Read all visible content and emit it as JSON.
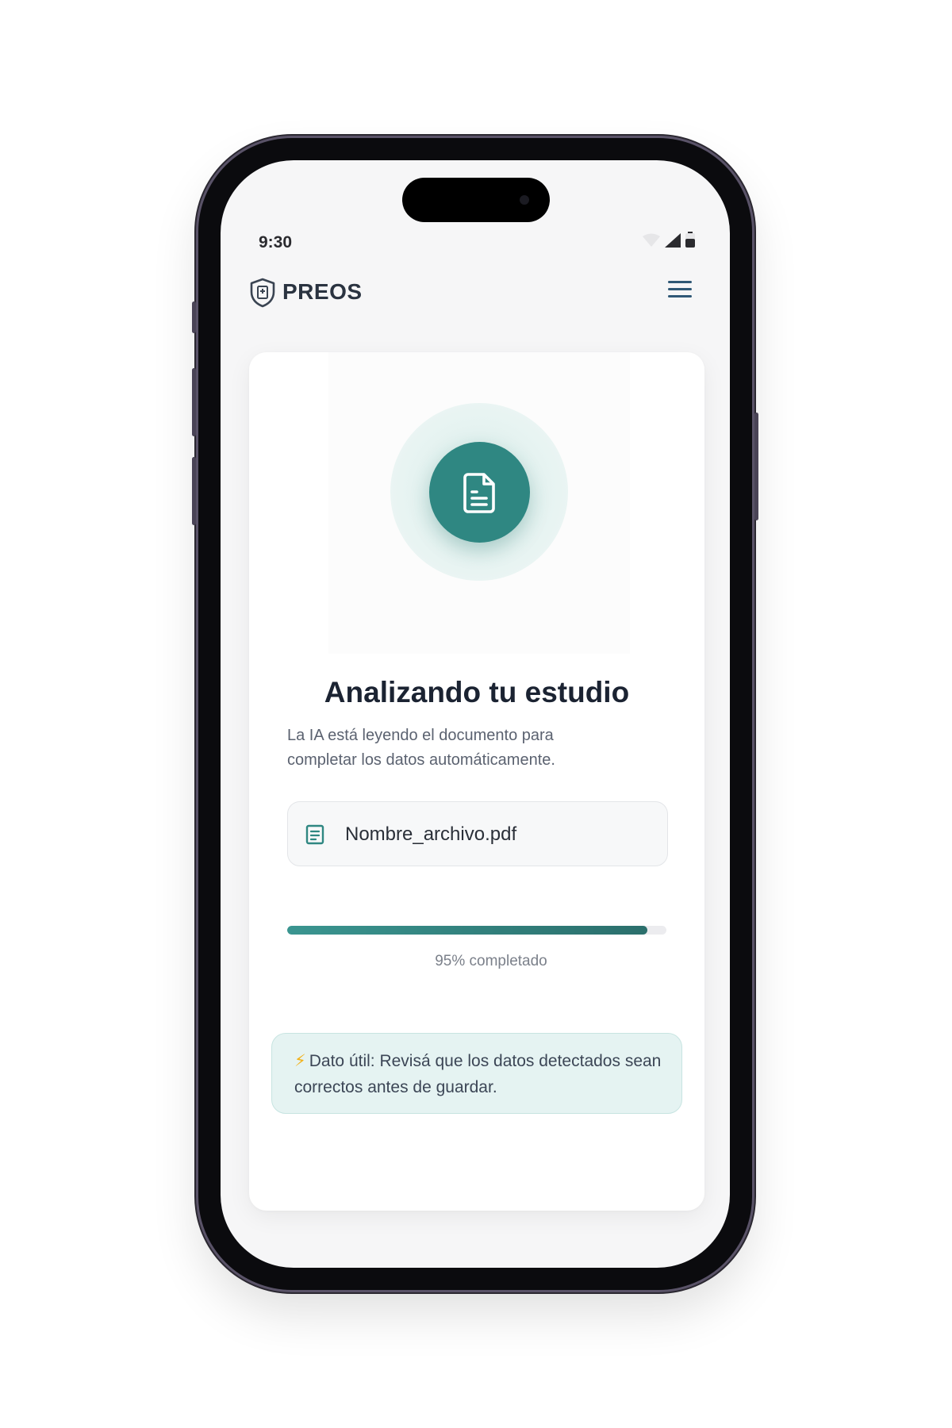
{
  "status_bar": {
    "time": "9:30"
  },
  "header": {
    "app_name": "PREOS"
  },
  "analysis": {
    "title": "Analizando tu estudio",
    "subtitle": "La IA está leyendo el documento para completar los datos automáticamente.",
    "file_name": "Nombre_archivo.pdf",
    "progress_percent": 95,
    "progress_label": "95% completado"
  },
  "tip": {
    "icon": "⚡",
    "text": "Dato útil: Revisá que los datos detectados sean correctos antes de guardar."
  },
  "colors": {
    "accent": "#2f8782",
    "title": "#1b2332",
    "tip_background": "#e5f3f2"
  }
}
